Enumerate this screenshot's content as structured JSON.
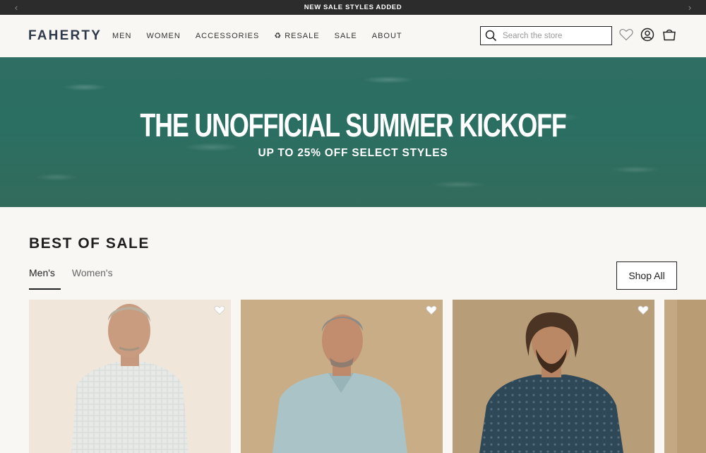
{
  "announcement": {
    "text": "NEW SALE STYLES ADDED"
  },
  "header": {
    "logo": "FAHERTY",
    "nav": [
      "MEN",
      "WOMEN",
      "ACCESSORIES",
      "RESALE",
      "SALE",
      "ABOUT"
    ],
    "search_placeholder": "Search the store"
  },
  "hero": {
    "title": "THE UNOFFICIAL SUMMER KICKOFF",
    "subtitle": "UP TO 25% OFF SELECT STYLES"
  },
  "section": {
    "title": "BEST OF SALE",
    "tabs": [
      "Men's",
      "Women's"
    ],
    "active_tab": "Men's",
    "shop_all": "Shop All"
  },
  "products": [
    {
      "bg": "#efe4d8",
      "shirt": "#e8ebe9",
      "hair": "#b8ab99",
      "skin": "#c89a7e"
    },
    {
      "bg": "#c5aa82",
      "shirt": "#a9c4c8",
      "hair": "#8a8a88",
      "skin": "#c08b6c"
    },
    {
      "bg": "#b59c76",
      "shirt": "#2f4a5a",
      "hair": "#4a3322",
      "skin": "#b98766"
    }
  ]
}
